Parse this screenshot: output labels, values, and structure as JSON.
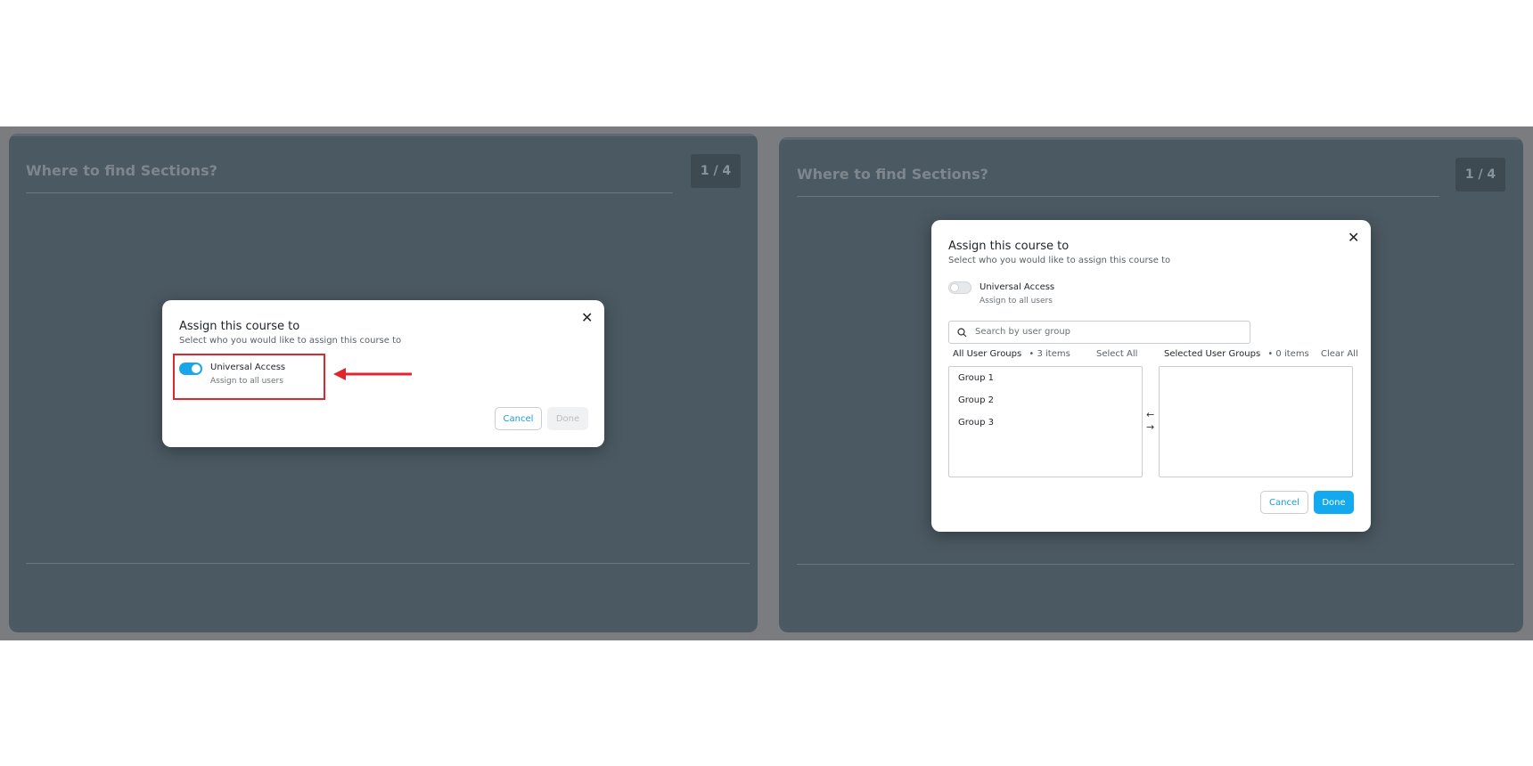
{
  "left_panel": {
    "title": "Where to find Sections?",
    "counter": "1 / 4",
    "modal": {
      "title": "Assign this course to",
      "subtitle": "Select who you would like to assign this course to",
      "close_icon": "close-icon",
      "toggle": {
        "label": "Universal Access",
        "sublabel": "Assign to all users",
        "state": "on"
      },
      "cancel_label": "Cancel",
      "done_label": "Done"
    },
    "annotation_color": "#e0262d"
  },
  "right_panel": {
    "title": "Where to find Sections?",
    "counter": "1 / 4",
    "modal": {
      "title": "Assign this course to",
      "subtitle": "Select who you would like to assign this course to",
      "close_icon": "close-icon",
      "toggle": {
        "label": "Universal Access",
        "sublabel": "Assign to all users",
        "state": "off"
      },
      "search_placeholder": "Search by user group",
      "all_groups": {
        "label": "All User Groups",
        "count": "•  3 items",
        "action": "Select All",
        "items": [
          "Group 1",
          "Group 2",
          "Group 3"
        ]
      },
      "selected_groups": {
        "label": "Selected User Groups",
        "count": "•  0 items",
        "action": "Clear All",
        "items": []
      },
      "transfer_left_icon": "←",
      "transfer_right_icon": "→",
      "cancel_label": "Cancel",
      "done_label": "Done"
    }
  },
  "colors": {
    "accent": "#13a9ee",
    "panel_bg": "#4b5962",
    "highlight": "#e0262d"
  }
}
